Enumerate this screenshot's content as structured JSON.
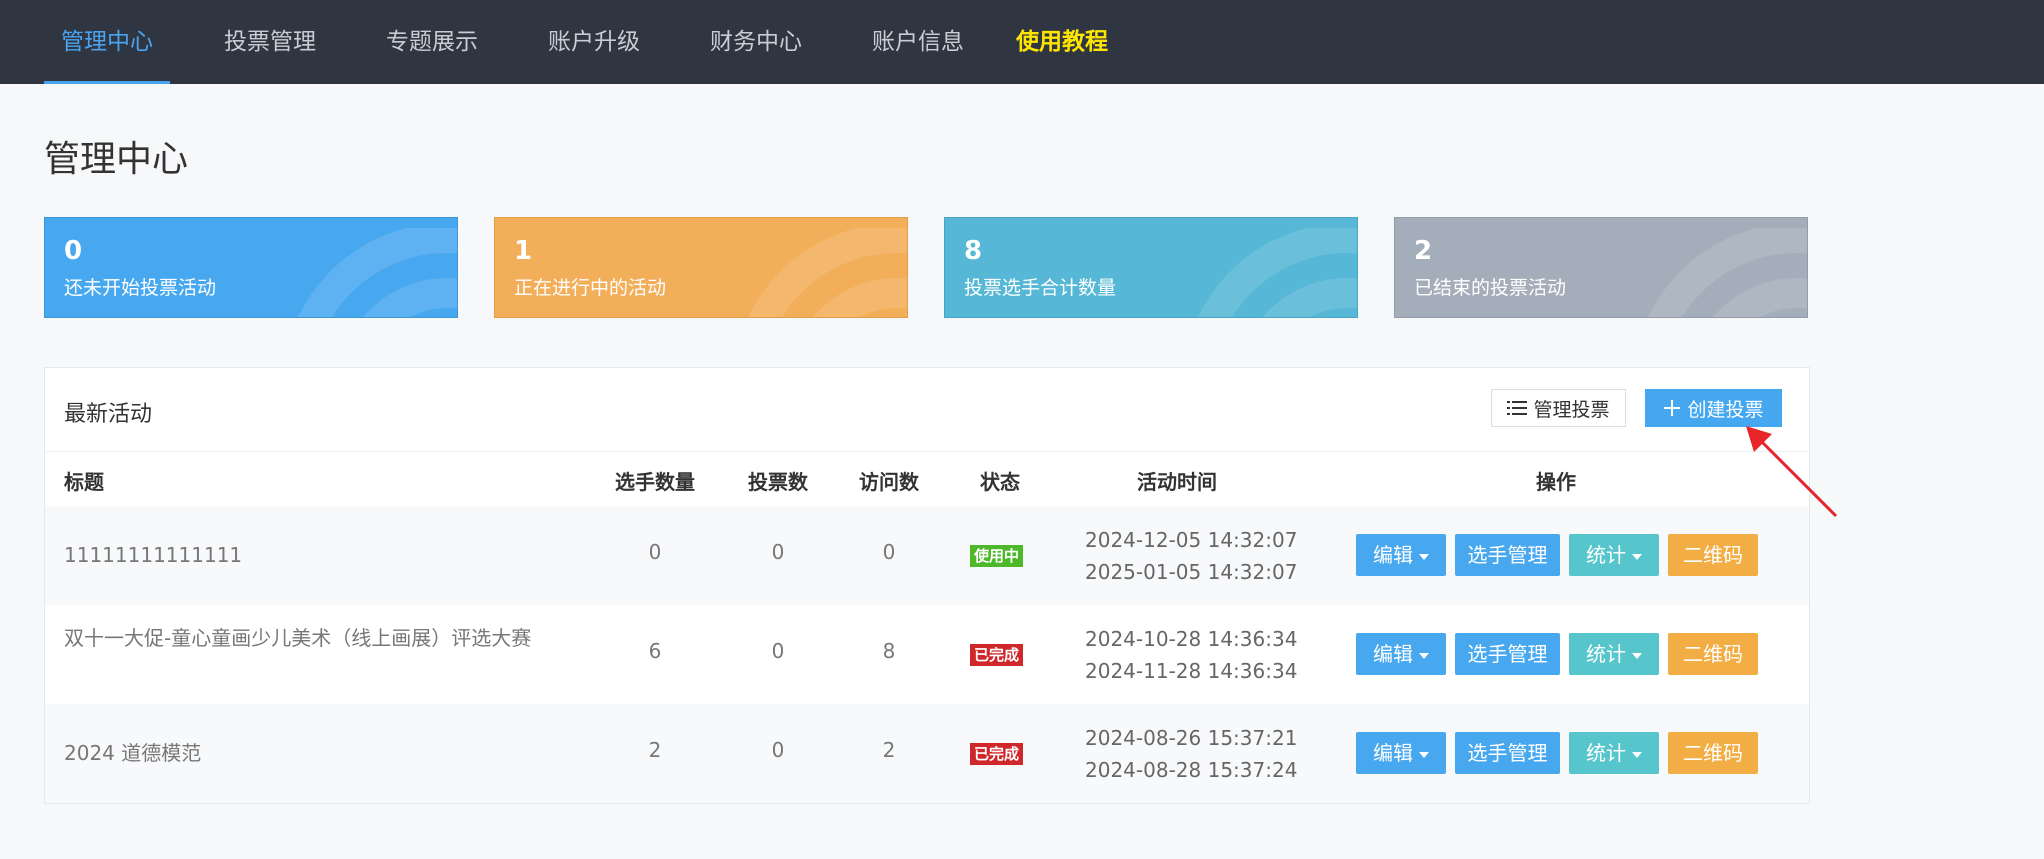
{
  "nav": {
    "items": [
      "管理中心",
      "投票管理",
      "专题展示",
      "账户升级",
      "财务中心",
      "账户信息",
      "使用教程"
    ]
  },
  "page": {
    "title": "管理中心"
  },
  "stats": [
    {
      "value": "0",
      "label": "还未开始投票活动",
      "color": "#48a8ef"
    },
    {
      "value": "1",
      "label": "正在进行中的活动",
      "color": "#f2ae59"
    },
    {
      "value": "8",
      "label": "投票选手合计数量",
      "color": "#56b8d6"
    },
    {
      "value": "2",
      "label": "已结束的投票活动",
      "color": "#a4adba"
    }
  ],
  "panel": {
    "title": "最新活动",
    "manage_label": "管理投票",
    "create_label": "创建投票"
  },
  "table": {
    "headers": [
      "标题",
      "选手数量",
      "投票数",
      "访问数",
      "状态",
      "活动时间",
      "操作"
    ],
    "rows": [
      {
        "title": "11111111111111",
        "players": "0",
        "votes": "0",
        "visits": "0",
        "status": "使用中",
        "start": "2024-12-05 14:32:07",
        "end": "2025-01-05 14:32:07"
      },
      {
        "title": "双十一大促-童心童画少儿美术（线上画展）评选大赛",
        "players": "6",
        "votes": "0",
        "visits": "8",
        "status": "已完成",
        "start": "2024-10-28 14:36:34",
        "end": "2024-11-28 14:36:34"
      },
      {
        "title": "2024 道德模范",
        "players": "2",
        "votes": "0",
        "visits": "2",
        "status": "已完成",
        "start": "2024-08-26 15:37:21",
        "end": "2024-08-28 15:37:24"
      }
    ],
    "actions": {
      "edit": "编辑",
      "candidates": "选手管理",
      "stats": "统计",
      "qrcode": "二维码"
    }
  },
  "colors": {
    "nav_bg": "#2f3541",
    "nav_active": "#4aa3f0",
    "nav_highlight": "#ffe600",
    "status_active": "#4cb82a",
    "status_done": "#d0282a",
    "annotation_arrow": "#e8262a"
  }
}
